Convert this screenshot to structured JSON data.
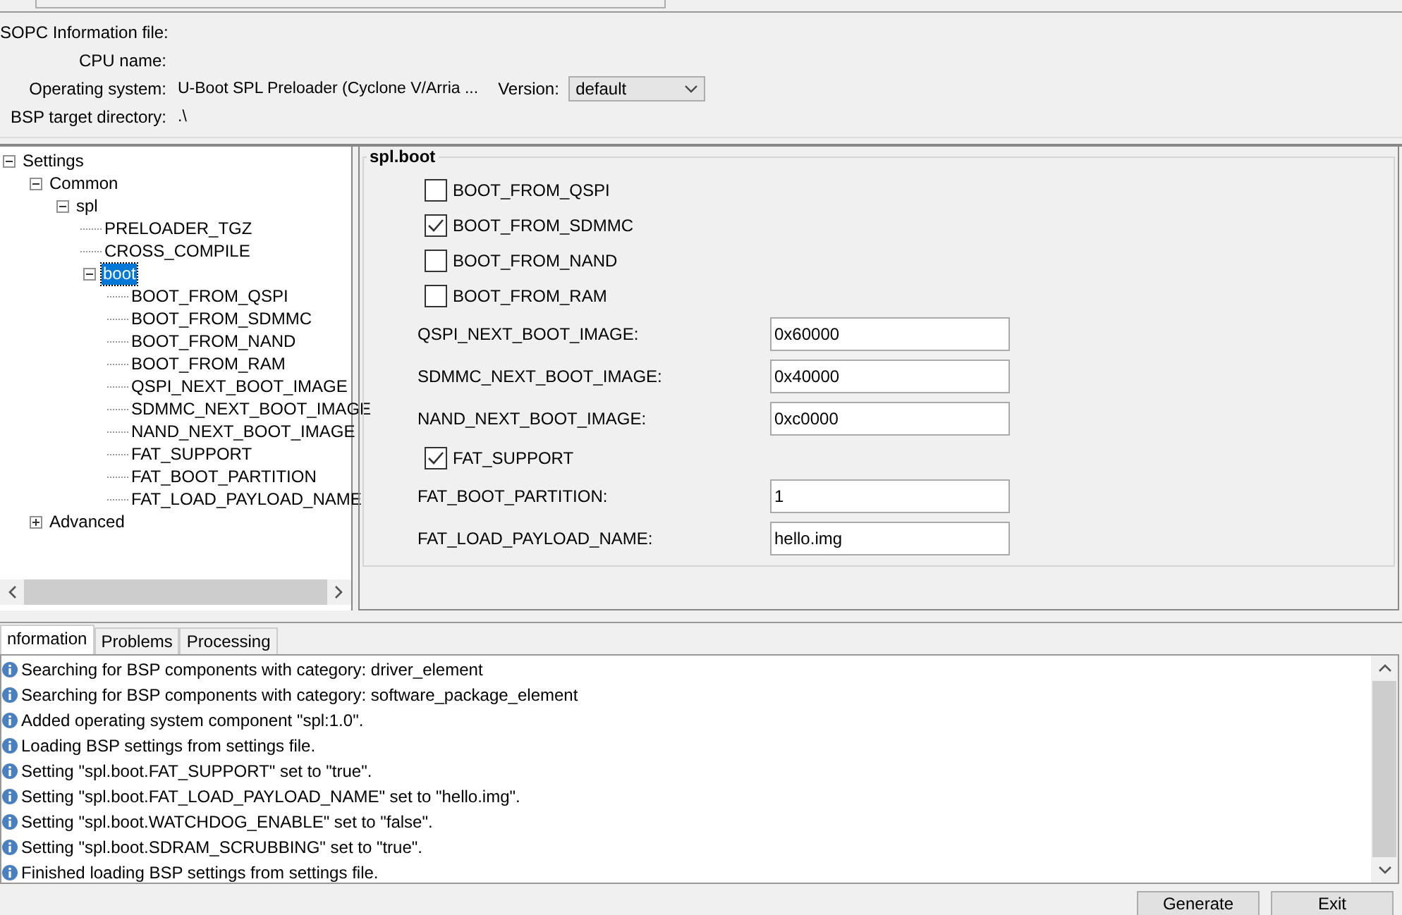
{
  "header": {
    "fields": [
      {
        "label": "SOPC Information file:"
      },
      {
        "label": "CPU name:"
      },
      {
        "label": "Operating system:",
        "value": "U-Boot SPL Preloader (Cyclone V/Arria ...",
        "version": {
          "label": "Version:",
          "value": "default"
        }
      },
      {
        "label": "BSP target directory:",
        "value": ".\\"
      }
    ]
  },
  "tree": {
    "items": [
      {
        "label": "Settings",
        "expanded": true,
        "selected": false,
        "children": [
          {
            "label": "Common",
            "expanded": true,
            "selected": false,
            "children": [
              {
                "label": "spl",
                "expanded": true,
                "selected": false,
                "children": [
                  {
                    "label": "PRELOADER_TGZ",
                    "selected": false
                  },
                  {
                    "label": "CROSS_COMPILE",
                    "selected": false
                  },
                  {
                    "label": "boot",
                    "expanded": true,
                    "selected": true,
                    "children": [
                      {
                        "label": "BOOT_FROM_QSPI",
                        "selected": false
                      },
                      {
                        "label": "BOOT_FROM_SDMMC",
                        "selected": false
                      },
                      {
                        "label": "BOOT_FROM_NAND",
                        "selected": false
                      },
                      {
                        "label": "BOOT_FROM_RAM",
                        "selected": false
                      },
                      {
                        "label": "QSPI_NEXT_BOOT_IMAGE",
                        "selected": false
                      },
                      {
                        "label": "SDMMC_NEXT_BOOT_IMAGE",
                        "selected": false
                      },
                      {
                        "label": "NAND_NEXT_BOOT_IMAGE",
                        "selected": false
                      },
                      {
                        "label": "FAT_SUPPORT",
                        "selected": false
                      },
                      {
                        "label": "FAT_BOOT_PARTITION",
                        "selected": false
                      },
                      {
                        "label": "FAT_LOAD_PAYLOAD_NAME",
                        "selected": false
                      }
                    ]
                  }
                ]
              }
            ]
          },
          {
            "label": "Advanced",
            "expanded": false,
            "selected": false
          }
        ]
      }
    ]
  },
  "panel": {
    "title": "spl.boot",
    "items": [
      {
        "kind": "checkbox",
        "label": "BOOT_FROM_QSPI",
        "checked": false
      },
      {
        "kind": "checkbox",
        "label": "BOOT_FROM_SDMMC",
        "checked": true
      },
      {
        "kind": "checkbox",
        "label": "BOOT_FROM_NAND",
        "checked": false
      },
      {
        "kind": "checkbox",
        "label": "BOOT_FROM_RAM",
        "checked": false
      },
      {
        "kind": "text",
        "label": "QSPI_NEXT_BOOT_IMAGE:",
        "value": "0x60000"
      },
      {
        "kind": "text",
        "label": "SDMMC_NEXT_BOOT_IMAGE:",
        "value": "0x40000"
      },
      {
        "kind": "text",
        "label": "NAND_NEXT_BOOT_IMAGE:",
        "value": "0xc0000"
      },
      {
        "kind": "checkbox",
        "label": "FAT_SUPPORT",
        "checked": true
      },
      {
        "kind": "text",
        "label": "FAT_BOOT_PARTITION:",
        "value": "1"
      },
      {
        "kind": "text",
        "label": "FAT_LOAD_PAYLOAD_NAME:",
        "value": "hello.img"
      }
    ]
  },
  "log": {
    "tabs": [
      {
        "label": "nformation",
        "selected": true
      },
      {
        "label": "Problems",
        "selected": false
      },
      {
        "label": "Processing",
        "selected": false
      }
    ],
    "messages": [
      "Searching for BSP components with category: driver_element",
      "Searching for BSP components with category: software_package_element",
      "Added operating system component \"spl:1.0\".",
      "Loading BSP settings from settings file.",
      "Setting \"spl.boot.FAT_SUPPORT\" set to \"true\".",
      "Setting \"spl.boot.FAT_LOAD_PAYLOAD_NAME\" set to \"hello.img\".",
      "Setting \"spl.boot.WATCHDOG_ENABLE\" set to \"false\".",
      "Setting \"spl.boot.SDRAM_SCRUBBING\" set to \"true\".",
      "Finished loading BSP settings from settings file."
    ]
  },
  "buttons": [
    {
      "label": "Generate"
    },
    {
      "label": "Exit"
    }
  ]
}
